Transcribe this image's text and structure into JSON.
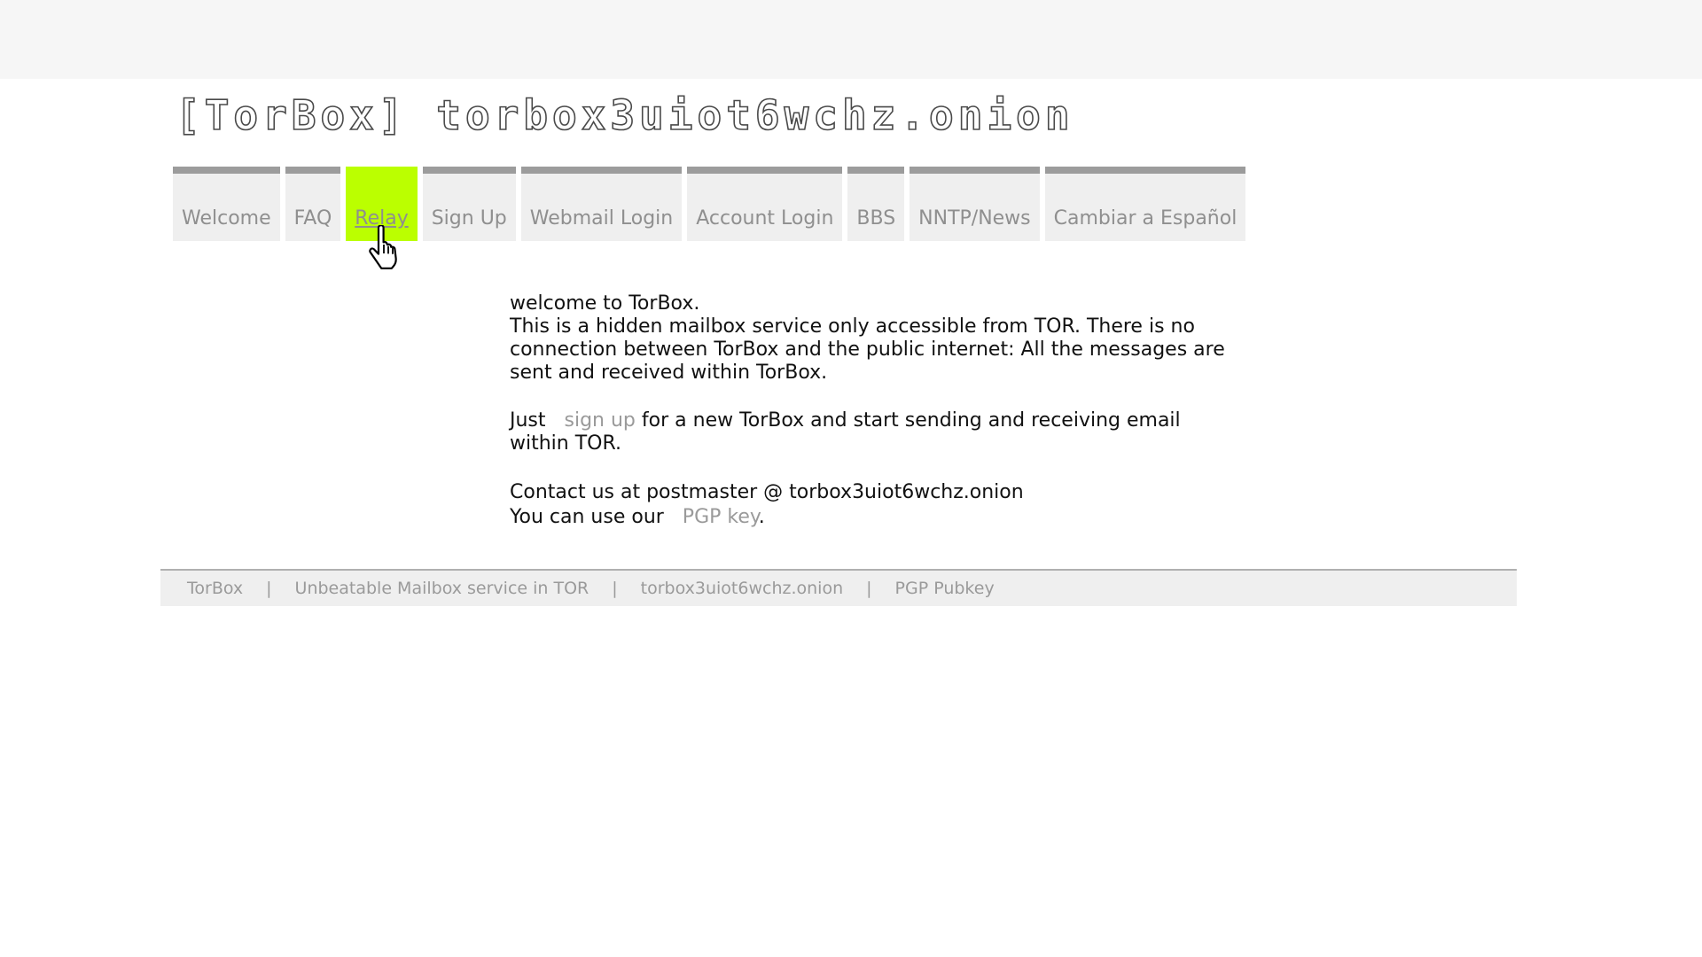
{
  "header": {
    "title": "[TorBox] torbox3uiot6wchz.onion"
  },
  "nav": {
    "tabs": [
      {
        "label": "Welcome"
      },
      {
        "label": "FAQ"
      },
      {
        "label": "Relay"
      },
      {
        "label": "Sign Up"
      },
      {
        "label": "Webmail Login"
      },
      {
        "label": "Account Login"
      },
      {
        "label": "BBS"
      },
      {
        "label": "NNTP/News"
      },
      {
        "label": "Cambiar a Español"
      }
    ],
    "active": "Relay"
  },
  "content": {
    "welcome": "welcome to TorBox.",
    "intro": "This is a hidden mailbox service only accessible from TOR. There is no connection between TorBox and the public internet: All the messages are sent and received within TorBox.",
    "just": "Just",
    "signup_link": "sign up",
    "signup_rest": "for a new TorBox and start sending and receiving email within TOR.",
    "contact": "Contact us at postmaster @ torbox3uiot6wchz.onion",
    "pgp_prefix": "You can use our",
    "pgp_link": "PGP key",
    "pgp_suffix": "."
  },
  "footer": {
    "items": [
      "TorBox",
      "Unbeatable Mailbox service in TOR",
      "torbox3uiot6wchz.onion",
      "PGP Pubkey"
    ],
    "separator": "|"
  },
  "colors": {
    "active_tab": "#bbff00",
    "tab_bg": "#efefef",
    "tab_border": "#9c9c9c",
    "link": "#9a9a9a"
  }
}
